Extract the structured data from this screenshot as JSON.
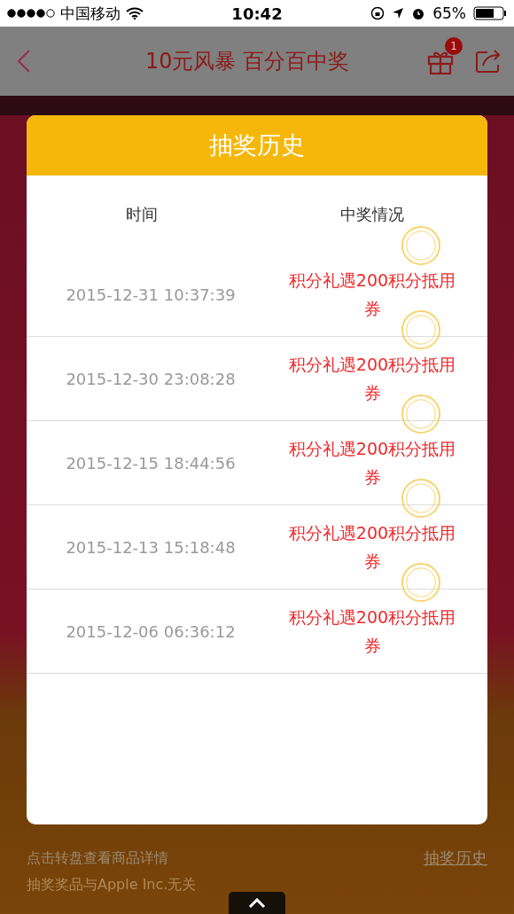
{
  "status_bar": {
    "carrier": "中国移动",
    "time": "10:42",
    "battery": "65%"
  },
  "nav": {
    "title": "10元风暴 百分百中奖",
    "gift_badge": "1"
  },
  "modal": {
    "title": "抽奖历史",
    "columns": [
      "时间",
      "中奖情况"
    ],
    "rows": [
      {
        "time": "2015-12-31 10:37:39",
        "prize": "积分礼遇200积分抵用券"
      },
      {
        "time": "2015-12-30 23:08:28",
        "prize": "积分礼遇200积分抵用券"
      },
      {
        "time": "2015-12-15 18:44:56",
        "prize": "积分礼遇200积分抵用券"
      },
      {
        "time": "2015-12-13 15:18:48",
        "prize": "积分礼遇200积分抵用券"
      },
      {
        "time": "2015-12-06 06:36:12",
        "prize": "积分礼遇200积分抵用券"
      }
    ]
  },
  "footer": {
    "hint": "点击转盘查看商品详情",
    "disclaimer": "抽奖奖品与Apple Inc.无关",
    "link": "抽奖历史"
  }
}
